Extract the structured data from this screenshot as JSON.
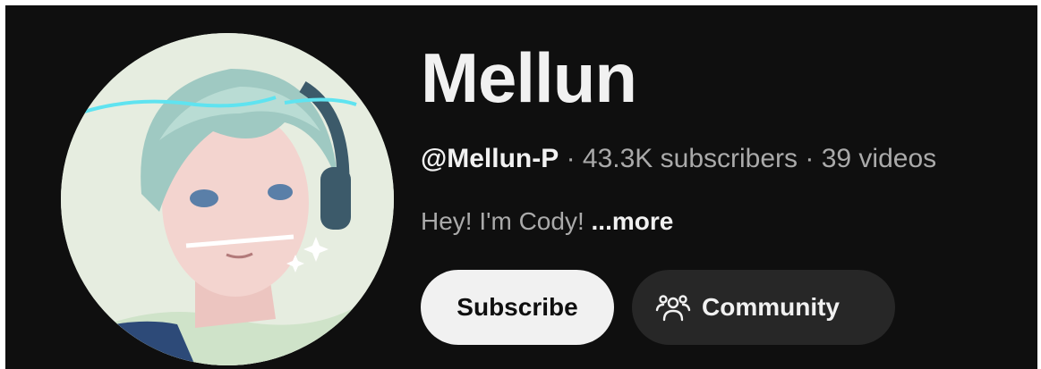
{
  "channel": {
    "name": "Mellun",
    "handle": "@Mellun-P",
    "separator": " · ",
    "subscribers": "43.3K subscribers",
    "videos": "39 videos",
    "description": "Hey! I'm Cody! ",
    "more_label": "...more"
  },
  "actions": {
    "subscribe_label": "Subscribe",
    "community_label": "Community",
    "community_icon": "community-people-icon"
  },
  "colors": {
    "background": "#0f0f0f",
    "primary_text": "#f1f1f1",
    "secondary_text": "#aaaaaa",
    "subscribe_bg": "#f1f1f1",
    "community_bg": "#272727"
  }
}
